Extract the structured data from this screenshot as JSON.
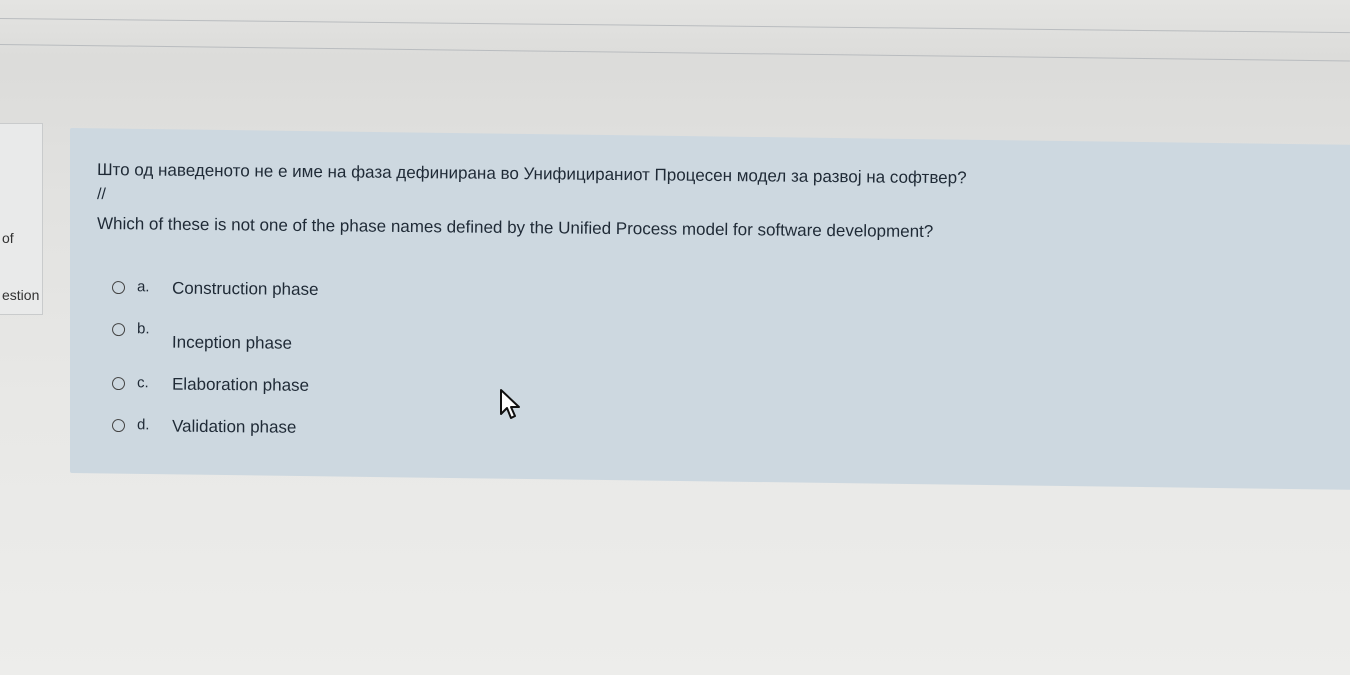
{
  "sidebar": {
    "of_label": "of",
    "question_label": "estion"
  },
  "question": {
    "text_mk": "Што од наведеното не е име на фаза дефинирана во Унифицираниот Процесен модел за развој на софтвер?",
    "separator": "//",
    "text_en": "Which of these is not one of the phase names defined by the Unified Process model for software development?"
  },
  "answers": [
    {
      "letter": "a.",
      "label": "Construction phase"
    },
    {
      "letter": "b.",
      "label": "Inception phase"
    },
    {
      "letter": "c.",
      "label": "Elaboration phase"
    },
    {
      "letter": "d.",
      "label": "Validation phase"
    }
  ],
  "icons": {
    "radio": "radio-circle",
    "cursor": "mouse-pointer-arrow"
  }
}
